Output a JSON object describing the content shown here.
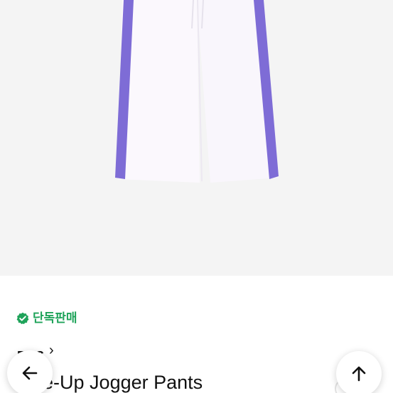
{
  "product": {
    "badge_label": "단독판매",
    "brand": "BTS",
    "brand_chevron": "›",
    "title": "Line-Up Jogger Pants"
  },
  "colors": {
    "image_background": "#f4f4f4",
    "pants_body": "#fbf8fd",
    "pants_stripe": "#7e6cd6",
    "badge_green": "#1fa35a"
  },
  "icons": {
    "badge": "check-badge-icon",
    "back": "arrow-left-icon",
    "top": "arrow-up-icon"
  }
}
